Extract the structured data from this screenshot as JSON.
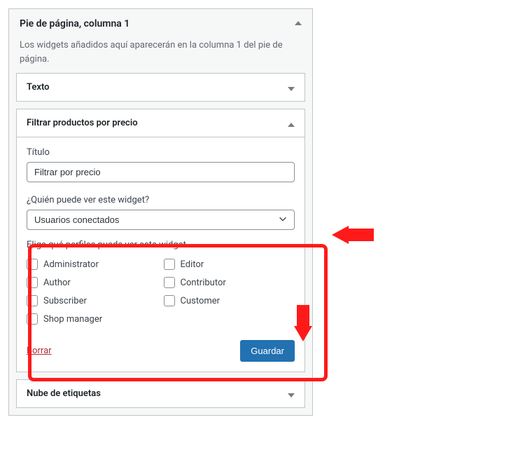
{
  "panel": {
    "title": "Pie de página, columna 1",
    "description": "Los widgets añadidos aquí aparecerán en la columna 1 del pie de página."
  },
  "widgets": {
    "text": {
      "title": "Texto"
    },
    "price": {
      "title": "Filtrar productos por precio",
      "titulo_label": "Título",
      "titulo_value": "Filtrar por precio",
      "visibility_label": "¿Quién puede ver este widget?",
      "visibility_value": "Usuarios conectados",
      "roles_label": "Elige qué perfiles puede ver este widget",
      "roles": {
        "admin": "Administrator",
        "editor": "Editor",
        "author": "Author",
        "contributor": "Contributor",
        "subscriber": "Subscriber",
        "customer": "Customer",
        "shopmgr": "Shop manager"
      },
      "delete": "Borrar",
      "save": "Guardar"
    },
    "tags": {
      "title": "Nube de etiquetas"
    }
  }
}
